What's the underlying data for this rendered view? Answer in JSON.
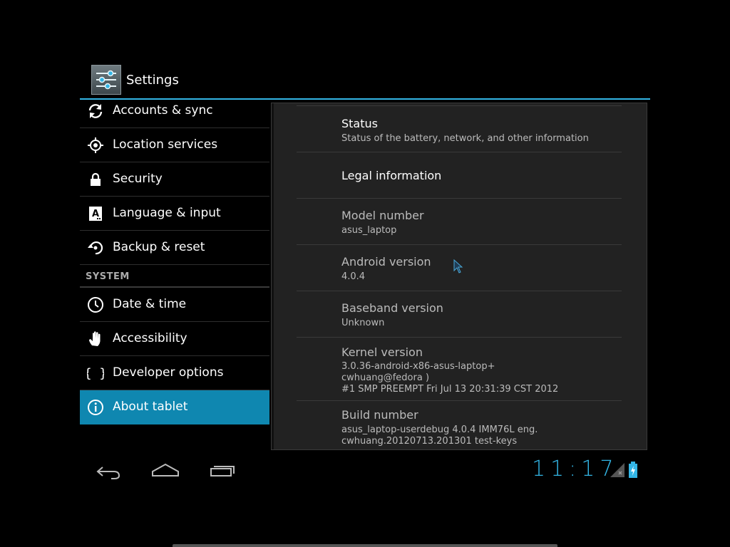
{
  "app": {
    "title": "Settings",
    "icon": "settings-sliders-icon",
    "accent_color": "#33b5e5",
    "selected_color": "#0f87b0"
  },
  "sidebar": {
    "items": [
      {
        "label": "Accounts & sync",
        "icon": "sync-icon"
      },
      {
        "label": "Location services",
        "icon": "location-icon"
      },
      {
        "label": "Security",
        "icon": "lock-icon"
      },
      {
        "label": "Language & input",
        "icon": "language-icon"
      },
      {
        "label": "Backup & reset",
        "icon": "backup-icon"
      }
    ],
    "section_header": "SYSTEM",
    "system_items": [
      {
        "label": "Date & time",
        "icon": "clock-icon"
      },
      {
        "label": "Accessibility",
        "icon": "hand-icon"
      },
      {
        "label": "Developer options",
        "icon": "braces-icon"
      },
      {
        "label": "About tablet",
        "icon": "info-icon",
        "selected": true
      }
    ]
  },
  "about": {
    "rows": [
      {
        "title": "Status",
        "subtitle": "Status of the battery, network, and other information"
      },
      {
        "title": "Legal information"
      },
      {
        "title": "Model number",
        "subtitle": "asus_laptop"
      },
      {
        "title": "Android version",
        "subtitle": "4.0.4"
      },
      {
        "title": "Baseband version",
        "subtitle": "Unknown"
      },
      {
        "title": "Kernel version",
        "subtitle_lines": [
          "3.0.36-android-x86-asus-laptop+",
          "cwhuang@fedora )",
          "#1 SMP PREEMPT Fri Jul 13 20:31:39 CST 2012"
        ]
      },
      {
        "title": "Build number",
        "subtitle_lines": [
          "asus_laptop-userdebug 4.0.4 IMM76L eng.",
          "cwhuang.20120713.201301 test-keys"
        ]
      }
    ]
  },
  "status_bar": {
    "time": "11:17",
    "icons": [
      "back-icon",
      "home-icon",
      "recents-icon",
      "signal-icon",
      "battery-charging-icon"
    ]
  }
}
